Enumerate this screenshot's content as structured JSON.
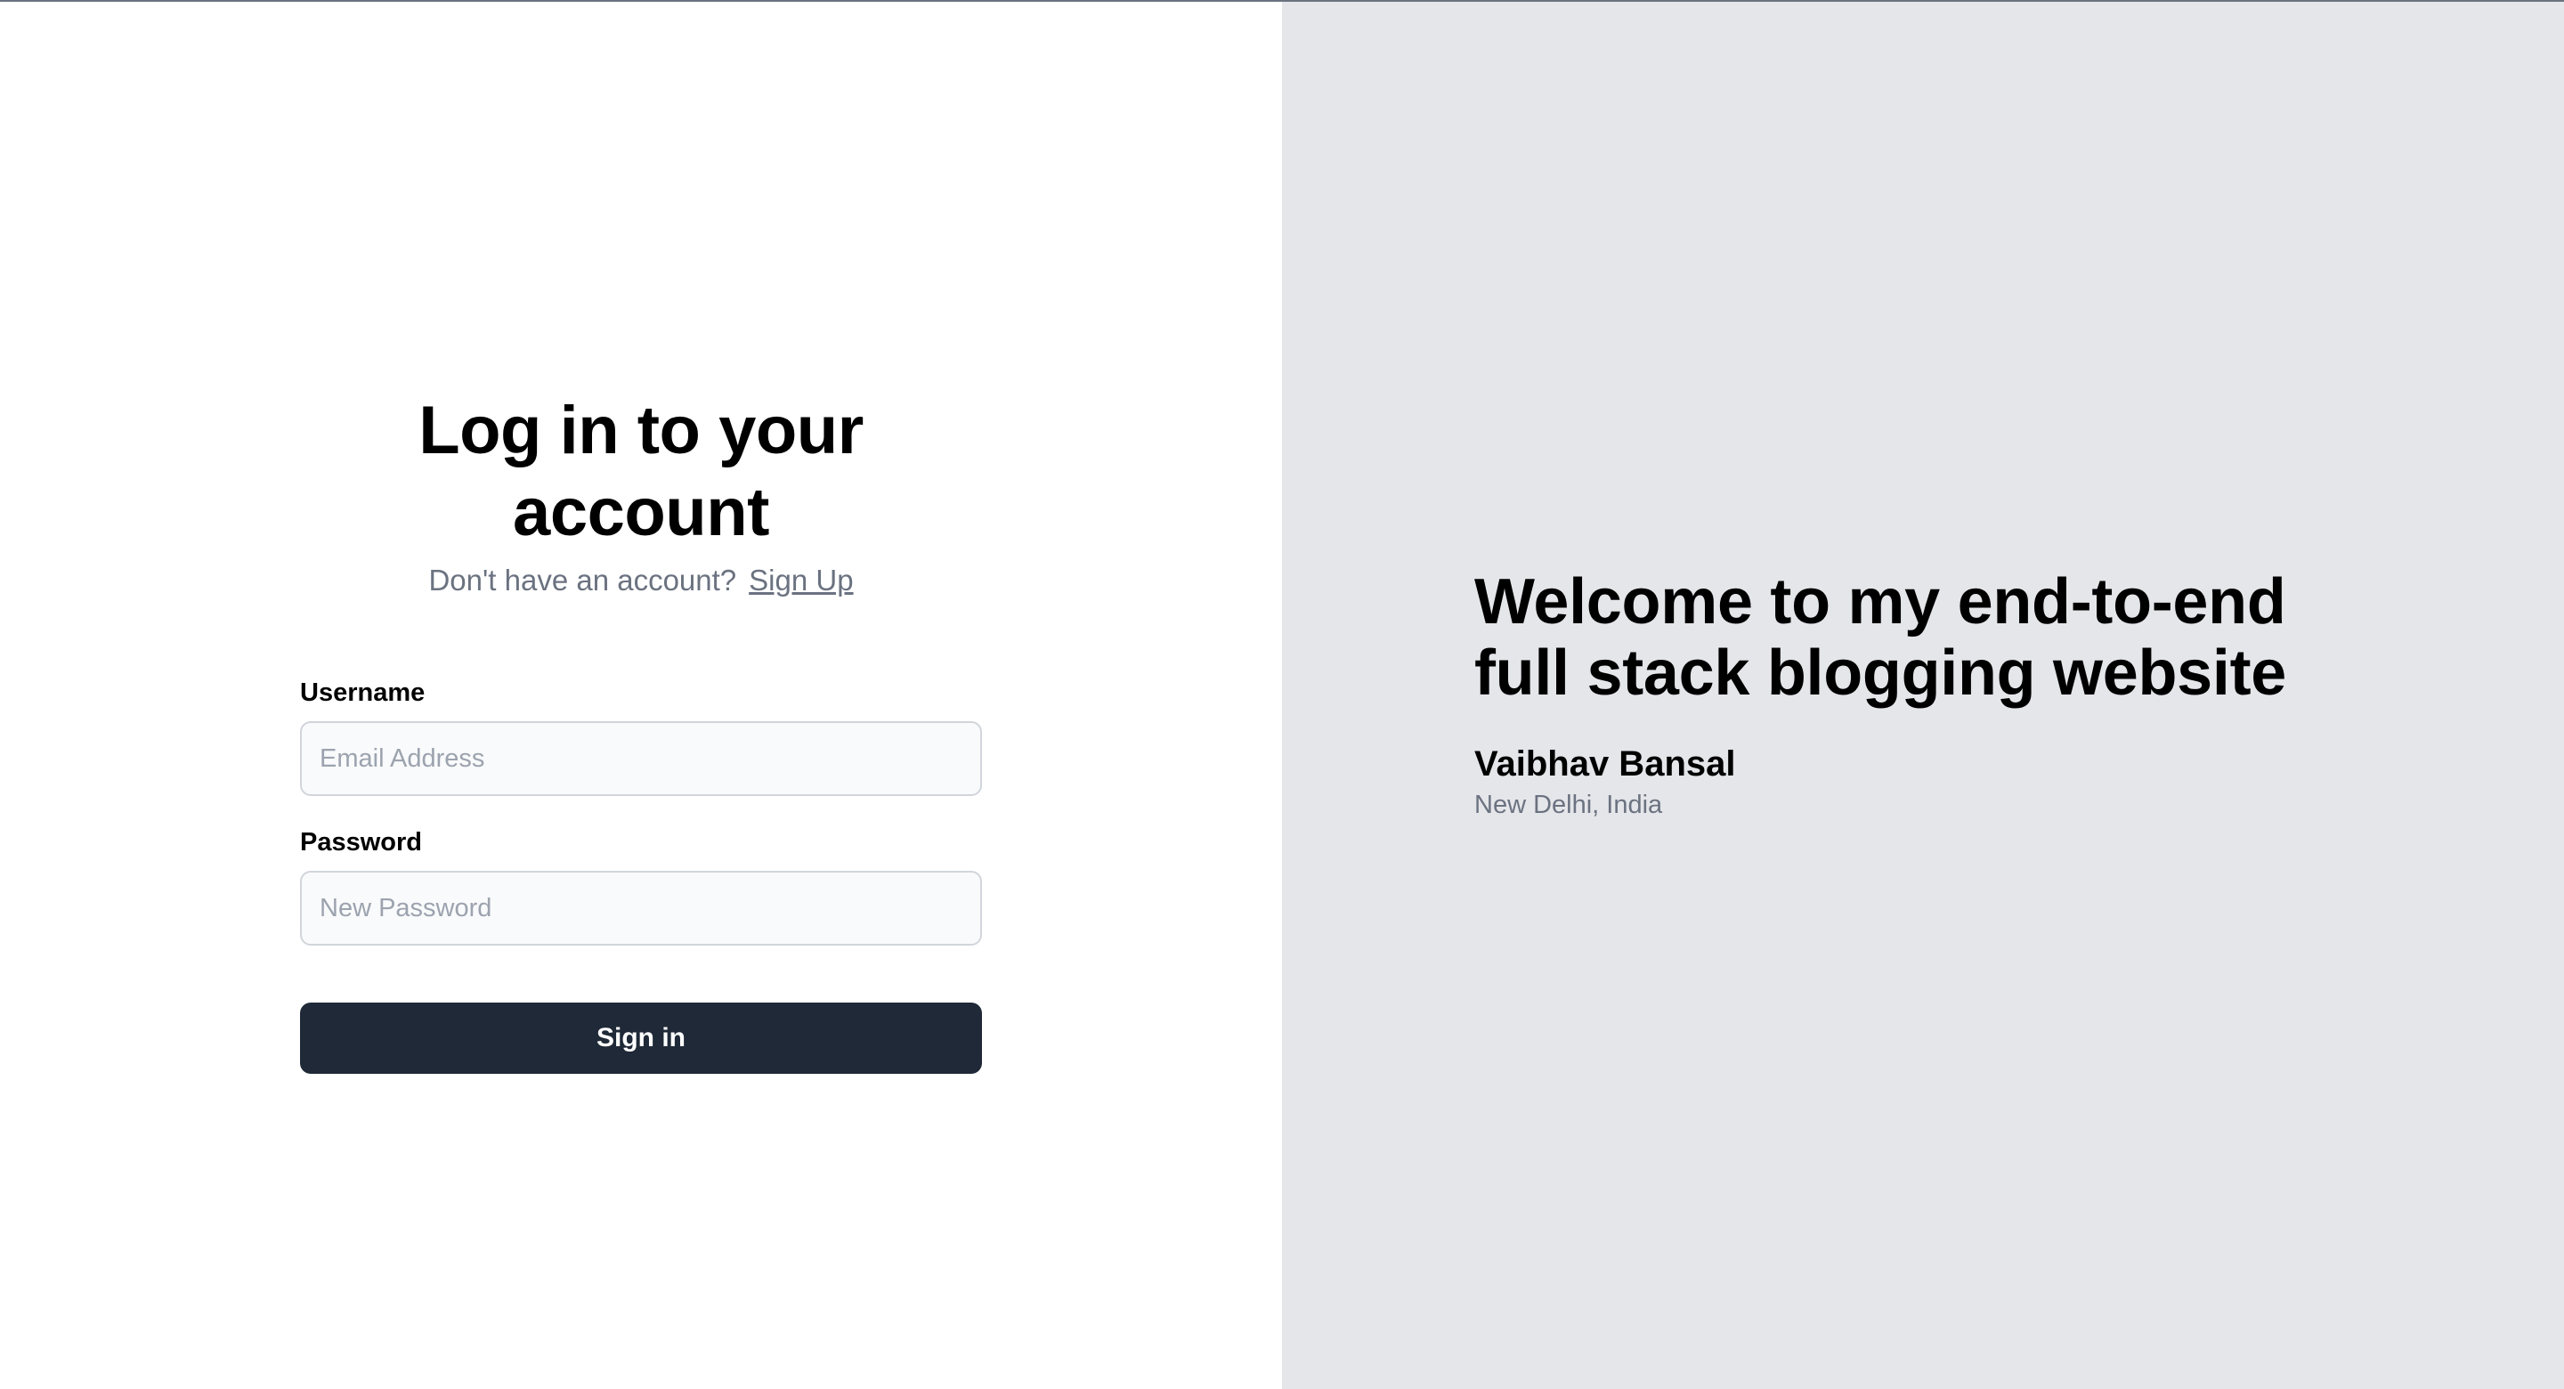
{
  "login": {
    "title": "Log in to your account",
    "prompt_text": "Don't have an account?",
    "signup_link": "Sign Up",
    "username_label": "Username",
    "username_placeholder": "Email Address",
    "username_value": "",
    "password_label": "Password",
    "password_placeholder": "New Password",
    "password_value": "",
    "signin_label": "Sign in"
  },
  "quote": {
    "headline": "Welcome to my end-to-end full stack blogging website",
    "author": "Vaibhav Bansal",
    "location": "New Delhi, India"
  },
  "colors": {
    "left_background": "#ffffff",
    "right_background": "#e5e6ea",
    "button_background": "#1f2937",
    "muted_text": "#6b7280"
  }
}
